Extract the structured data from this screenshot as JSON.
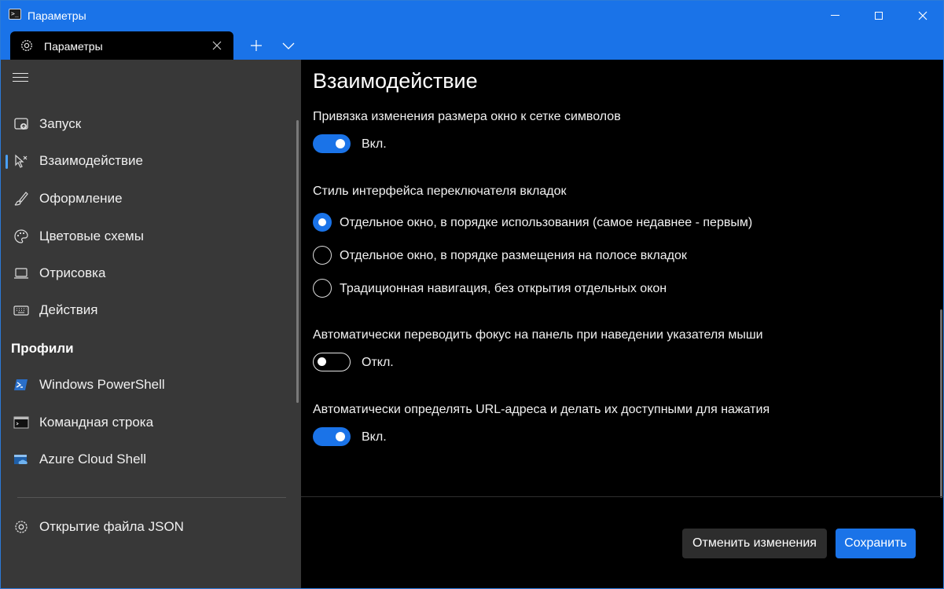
{
  "titlebar": {
    "title": "Параметры"
  },
  "tab": {
    "label": "Параметры"
  },
  "sidebar": {
    "items": [
      {
        "label": "Запуск",
        "icon": "startup-icon"
      },
      {
        "label": "Взаимодействие",
        "icon": "interaction-icon"
      },
      {
        "label": "Оформление",
        "icon": "brush-icon"
      },
      {
        "label": "Цветовые схемы",
        "icon": "palette-icon"
      },
      {
        "label": "Отрисовка",
        "icon": "laptop-icon"
      },
      {
        "label": "Действия",
        "icon": "keyboard-icon"
      }
    ],
    "profiles_header": "Профили",
    "profiles": [
      {
        "label": "Windows PowerShell",
        "icon": "powershell-icon"
      },
      {
        "label": "Командная строка",
        "icon": "cmd-icon"
      },
      {
        "label": "Azure Cloud Shell",
        "icon": "azure-icon"
      }
    ],
    "open_json": "Открытие файла JSON",
    "selected": "Взаимодействие"
  },
  "main": {
    "title": "Взаимодействие",
    "snap_resize": {
      "label": "Привязка изменения размера окно к сетке символов",
      "state": "Вкл."
    },
    "tab_switcher": {
      "label": "Стиль интерфейса переключателя вкладок",
      "options": [
        "Отдельное окно, в порядке использования (самое недавнее - первым)",
        "Отдельное окно, в порядке размещения на полосе вкладок",
        "Традиционная навигация, без открытия отдельных окон"
      ],
      "selected_index": 0
    },
    "focus_follow_mouse": {
      "label": "Автоматически переводить фокус на панель при наведении указателя мыши",
      "state": "Откл."
    },
    "detect_urls": {
      "label": "Автоматически определять URL-адреса и делать их доступными для нажатия",
      "state": "Вкл."
    }
  },
  "footer": {
    "discard_label": "Отменить изменения",
    "save_label": "Сохранить"
  },
  "colors": {
    "accent": "#1a73e8",
    "sidebar_bg": "#383838",
    "main_bg": "#000000"
  }
}
